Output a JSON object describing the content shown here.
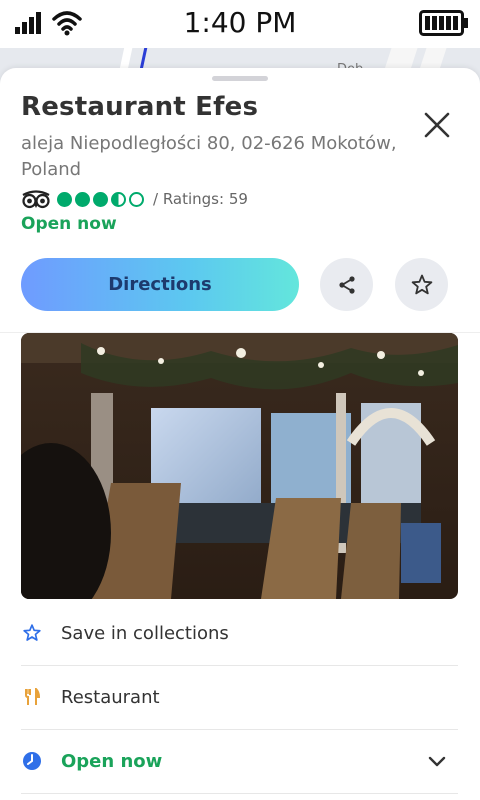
{
  "status_bar": {
    "time": "1:40 PM"
  },
  "map": {
    "label": "Dęb"
  },
  "place": {
    "name": "Restaurant Efes",
    "address": "aleja Niepodległości 80, 02-626 Mokotów, Poland",
    "rating": {
      "bubbles": 3.5,
      "max": 5,
      "ratings_text": "/ Ratings: 59",
      "accent": "#00aa6c"
    },
    "status": "Open now"
  },
  "actions": {
    "directions_label": "Directions",
    "share_icon": "share-icon",
    "favorite_icon": "star-icon"
  },
  "details": [
    {
      "icon": "star-outline-icon",
      "label": "Save in collections"
    },
    {
      "icon": "restaurant-icon",
      "label": "Restaurant"
    },
    {
      "icon": "clock-icon",
      "label": "Open now"
    }
  ],
  "colors": {
    "open_green": "#1aa35a",
    "accent_blue": "#2f6fe8",
    "restaurant_orange": "#e8a23a"
  }
}
